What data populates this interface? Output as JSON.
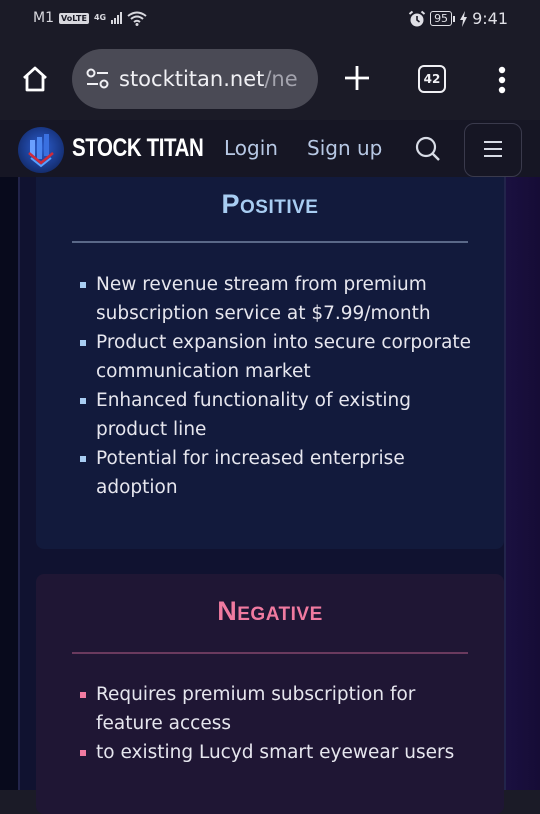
{
  "status_bar": {
    "carrier": "M1",
    "volte_badge": "VoLTE",
    "network_type": "4G",
    "battery_level": "95",
    "time": "9:41",
    "icons": [
      "signal-icon",
      "wifi-icon",
      "alarm-icon",
      "battery-icon",
      "charging-icon"
    ]
  },
  "browser": {
    "url_main": "stocktitan.net",
    "url_dim": "/ne",
    "tab_count": "42",
    "icons": [
      "home-icon",
      "site-settings-icon",
      "new-tab-icon",
      "tabs-icon",
      "more-icon"
    ]
  },
  "site_header": {
    "brand": "STOCK TITAN",
    "login_label": "Login",
    "signup_label": "Sign up",
    "icons": [
      "logo-icon",
      "search-icon",
      "hamburger-menu-icon"
    ]
  },
  "positive": {
    "title": "Positive",
    "items": [
      "New revenue stream from premium subscription service at $7.99/month",
      "Product expansion into secure corporate communication market",
      "Enhanced functionality of existing product line",
      "Potential for increased enterprise adoption"
    ],
    "accent_color": "#a8cdf2"
  },
  "negative": {
    "title": "Negative",
    "items": [
      "Requires premium subscription for feature access",
      "to existing Lucyd smart eyewear users"
    ],
    "accent_color": "#f07aa0"
  }
}
